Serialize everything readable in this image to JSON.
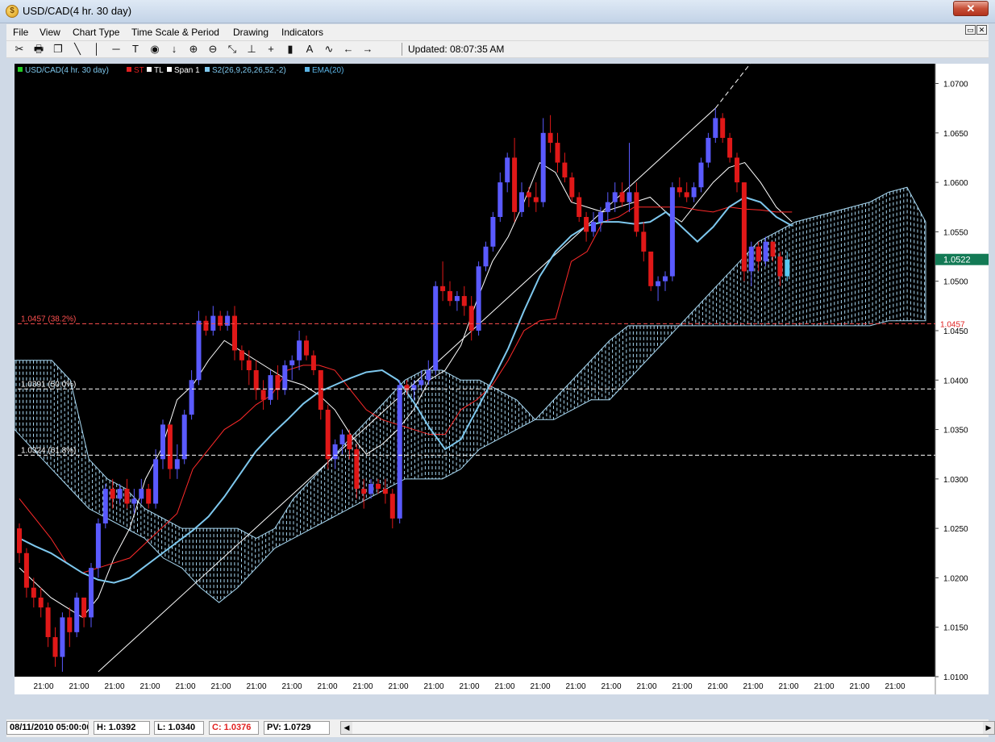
{
  "window": {
    "title": "USD/CAD(4 hr.  30 day)",
    "close_label": "✕"
  },
  "menu": [
    "File",
    "View",
    "Chart Type",
    "Time Scale & Period",
    "Drawing",
    "Indicators"
  ],
  "toolbar": {
    "icons": [
      "scissors-icon",
      "print-icon",
      "copy-icon",
      "line-icon",
      "vertical-line-icon",
      "horizontal-line-icon",
      "text-icon",
      "circle-icon",
      "arrow-down-icon",
      "zoom-in-icon",
      "zoom-out-icon",
      "fit-icon",
      "align-icon",
      "plus-icon",
      "bar-icon",
      "a-icon",
      "wave-icon",
      "arrow-left-icon",
      "arrow-right-icon"
    ],
    "glyphs": [
      "✂",
      "🖶",
      "❐",
      "╲",
      "│",
      "─",
      "T",
      "◉",
      "↓",
      "⊕",
      "⊖",
      "⤡",
      "⊥",
      "+",
      "▮",
      "A",
      "∿",
      "←",
      "→"
    ],
    "updated": "Updated: 08:07:35 AM"
  },
  "legend": [
    {
      "label": "USD/CAD(4 hr.  30 day)",
      "color": "#22cc22"
    },
    {
      "label": "ST",
      "color": "#e02020"
    },
    {
      "label": "TL",
      "color": "#ffffff"
    },
    {
      "label": "Span 1",
      "color": "#ffffff"
    },
    {
      "label": "S2(26,9,26,26,52,-2)",
      "color": "#7ec8ee"
    },
    {
      "label": "EMA(20)",
      "color": "#5ab4e6"
    }
  ],
  "colors": {
    "bull": "#5a5aff",
    "bear": "#e01818",
    "last": "#5ac8f0",
    "cloud": "#a8d8f2",
    "tenkan": "#ff2a2a",
    "kijun_line": "#ffffff",
    "ema": "#7ec8ee",
    "current_badge": "#137a55"
  },
  "chart_data": {
    "type": "candlestick",
    "symbol": "USD/CAD",
    "period": "4 hr.  30 day",
    "ylim": [
      1.01,
      1.072
    ],
    "y_ticks": [
      "1.0700",
      "1.0650",
      "1.0600",
      "1.0550",
      "1.0500",
      "1.0450",
      "1.0400",
      "1.0350",
      "1.0300",
      "1.0250",
      "1.0200",
      "1.0150",
      "1.0100"
    ],
    "x_ticks": [
      "21:00",
      "21:00",
      "21:00",
      "21:00",
      "21:00",
      "21:00",
      "21:00",
      "21:00",
      "21:00",
      "21:00",
      "21:00",
      "21:00",
      "21:00",
      "21:00",
      "21:00",
      "21:00",
      "21:00",
      "21:00",
      "21:00",
      "21:00",
      "21:00",
      "21:00",
      "21:00",
      "21:00",
      "21:00"
    ],
    "current_price": "1.0522",
    "fib_levels": [
      {
        "label": "1.0457 (38.2%)",
        "value": 1.0457,
        "color": "#ff5050"
      },
      {
        "label": "1.0391 (50.0%)",
        "value": 1.0391,
        "color": "#ffffff"
      },
      {
        "label": "1.0324 (61.8%)",
        "value": 1.0324,
        "color": "#ffffff"
      }
    ],
    "right_marker": "1.0457",
    "trendline": {
      "x": [
        11,
        185
      ],
      "y": [
        1.0105,
        1.074
      ]
    },
    "candles": [
      [
        1.025,
        1.0255,
        1.0215,
        1.0225
      ],
      [
        1.0225,
        1.023,
        1.018,
        1.019
      ],
      [
        1.019,
        1.02,
        1.017,
        1.018
      ],
      [
        1.018,
        1.019,
        1.016,
        1.017
      ],
      [
        1.017,
        1.0175,
        1.013,
        1.014
      ],
      [
        1.014,
        1.015,
        1.011,
        1.012
      ],
      [
        1.012,
        1.0165,
        1.0105,
        1.016
      ],
      [
        1.016,
        1.017,
        1.013,
        1.0145
      ],
      [
        1.0145,
        1.0185,
        1.014,
        1.018
      ],
      [
        1.018,
        1.0175,
        1.015,
        1.016
      ],
      [
        1.016,
        1.0215,
        1.015,
        1.021
      ],
      [
        1.021,
        1.026,
        1.02,
        1.0255
      ],
      [
        1.0255,
        1.0295,
        1.025,
        1.029
      ],
      [
        1.029,
        1.03,
        1.027,
        1.028
      ],
      [
        1.028,
        1.0295,
        1.0275,
        1.029
      ],
      [
        1.029,
        1.03,
        1.027,
        1.0275
      ],
      [
        1.0275,
        1.029,
        1.0265,
        1.028
      ],
      [
        1.028,
        1.03,
        1.0275,
        1.029
      ],
      [
        1.029,
        1.0295,
        1.027,
        1.0275
      ],
      [
        1.0275,
        1.033,
        1.027,
        1.032
      ],
      [
        1.032,
        1.036,
        1.031,
        1.0355
      ],
      [
        1.0355,
        1.035,
        1.03,
        1.031
      ],
      [
        1.031,
        1.0335,
        1.03,
        1.032
      ],
      [
        1.032,
        1.037,
        1.0315,
        1.0365
      ],
      [
        1.0365,
        1.041,
        1.036,
        1.04
      ],
      [
        1.04,
        1.047,
        1.0395,
        1.046
      ],
      [
        1.046,
        1.0465,
        1.0445,
        1.045
      ],
      [
        1.045,
        1.0475,
        1.0445,
        1.0465
      ],
      [
        1.0465,
        1.047,
        1.045,
        1.0455
      ],
      [
        1.0455,
        1.047,
        1.045,
        1.0465
      ],
      [
        1.0465,
        1.0475,
        1.042,
        1.043
      ],
      [
        1.043,
        1.0435,
        1.041,
        1.042
      ],
      [
        1.042,
        1.043,
        1.0395,
        1.041
      ],
      [
        1.041,
        1.042,
        1.038,
        1.039
      ],
      [
        1.039,
        1.04,
        1.037,
        1.038
      ],
      [
        1.038,
        1.041,
        1.0375,
        1.0405
      ],
      [
        1.0405,
        1.0415,
        1.038,
        1.039
      ],
      [
        1.039,
        1.042,
        1.0385,
        1.0415
      ],
      [
        1.0415,
        1.0425,
        1.04,
        1.042
      ],
      [
        1.042,
        1.045,
        1.041,
        1.044
      ],
      [
        1.044,
        1.0445,
        1.042,
        1.0425
      ],
      [
        1.0425,
        1.043,
        1.0405,
        1.041
      ],
      [
        1.041,
        1.0405,
        1.036,
        1.037
      ],
      [
        1.037,
        1.0375,
        1.031,
        1.032
      ],
      [
        1.032,
        1.034,
        1.031,
        1.0335
      ],
      [
        1.0335,
        1.035,
        1.0325,
        1.0345
      ],
      [
        1.0345,
        1.035,
        1.032,
        1.033
      ],
      [
        1.033,
        1.0335,
        1.028,
        1.029
      ],
      [
        1.029,
        1.03,
        1.027,
        1.0285
      ],
      [
        1.0285,
        1.03,
        1.028,
        1.0295
      ],
      [
        1.0295,
        1.03,
        1.0285,
        1.029
      ],
      [
        1.029,
        1.03,
        1.0275,
        1.0285
      ],
      [
        1.0285,
        1.029,
        1.025,
        1.026
      ],
      [
        1.026,
        1.04,
        1.0255,
        1.0395
      ],
      [
        1.0395,
        1.04,
        1.0385,
        1.039
      ],
      [
        1.039,
        1.04,
        1.038,
        1.0395
      ],
      [
        1.0395,
        1.041,
        1.039,
        1.04
      ],
      [
        1.04,
        1.042,
        1.0395,
        1.041
      ],
      [
        1.041,
        1.05,
        1.0405,
        1.0495
      ],
      [
        1.0495,
        1.052,
        1.048,
        1.049
      ],
      [
        1.049,
        1.05,
        1.0475,
        1.048
      ],
      [
        1.048,
        1.049,
        1.047,
        1.0485
      ],
      [
        1.0485,
        1.0495,
        1.0465,
        1.0475
      ],
      [
        1.0475,
        1.0485,
        1.044,
        1.045
      ],
      [
        1.045,
        1.052,
        1.0445,
        1.0515
      ],
      [
        1.0515,
        1.054,
        1.051,
        1.0535
      ],
      [
        1.0535,
        1.057,
        1.053,
        1.0565
      ],
      [
        1.0565,
        1.061,
        1.056,
        1.06
      ],
      [
        1.06,
        1.063,
        1.059,
        1.0625
      ],
      [
        1.0625,
        1.0645,
        1.056,
        1.057
      ],
      [
        1.057,
        1.06,
        1.0565,
        1.059
      ],
      [
        1.059,
        1.0595,
        1.0575,
        1.0585
      ],
      [
        1.0585,
        1.06,
        1.057,
        1.058
      ],
      [
        1.058,
        1.0665,
        1.0575,
        1.065
      ],
      [
        1.065,
        1.0668,
        1.063,
        1.064
      ],
      [
        1.064,
        1.065,
        1.061,
        1.062
      ],
      [
        1.062,
        1.063,
        1.06,
        1.0605
      ],
      [
        1.0605,
        1.061,
        1.058,
        1.0585
      ],
      [
        1.0585,
        1.059,
        1.056,
        1.0565
      ],
      [
        1.0565,
        1.057,
        1.054,
        1.055
      ],
      [
        1.055,
        1.057,
        1.0545,
        1.056
      ],
      [
        1.056,
        1.0575,
        1.055,
        1.057
      ],
      [
        1.057,
        1.059,
        1.056,
        1.058
      ],
      [
        1.058,
        1.06,
        1.057,
        1.059
      ],
      [
        1.059,
        1.06,
        1.0575,
        1.058
      ],
      [
        1.058,
        1.064,
        1.057,
        1.059
      ],
      [
        1.059,
        1.06,
        1.0545,
        1.055
      ],
      [
        1.055,
        1.056,
        1.052,
        1.053
      ],
      [
        1.053,
        1.051,
        1.049,
        1.0495
      ],
      [
        1.0495,
        1.0505,
        1.048,
        1.05
      ],
      [
        1.05,
        1.051,
        1.049,
        1.0505
      ],
      [
        1.0505,
        1.06,
        1.05,
        1.0595
      ],
      [
        1.0595,
        1.0605,
        1.0585,
        1.059
      ],
      [
        1.059,
        1.06,
        1.058,
        1.0585
      ],
      [
        1.0585,
        1.06,
        1.058,
        1.0595
      ],
      [
        1.0595,
        1.0625,
        1.059,
        1.062
      ],
      [
        1.062,
        1.065,
        1.0615,
        1.0645
      ],
      [
        1.0645,
        1.0675,
        1.064,
        1.0665
      ],
      [
        1.0665,
        1.067,
        1.064,
        1.0645
      ],
      [
        1.0645,
        1.065,
        1.062,
        1.0625
      ],
      [
        1.0625,
        1.063,
        1.059,
        1.06
      ],
      [
        1.06,
        1.06,
        1.05,
        1.051
      ],
      [
        1.051,
        1.054,
        1.0495,
        1.0535
      ],
      [
        1.0535,
        1.054,
        1.051,
        1.052
      ],
      [
        1.052,
        1.0545,
        1.0515,
        1.054
      ],
      [
        1.054,
        1.054,
        1.052,
        1.0525
      ],
      [
        1.0525,
        1.053,
        1.0495,
        1.0505
      ],
      [
        1.0505,
        1.053,
        1.05,
        1.0522
      ]
    ],
    "ema20": [
      1.024,
      1.0232,
      1.0225,
      1.0215,
      1.0205,
      1.0198,
      1.0195,
      1.02,
      1.0212,
      1.0224,
      1.0236,
      1.0248,
      1.0262,
      1.0282,
      1.0305,
      1.0328,
      1.0345,
      1.036,
      1.0376,
      1.0388,
      1.0395,
      1.0402,
      1.0408,
      1.041,
      1.04,
      1.0378,
      1.0352,
      1.033,
      1.034,
      1.037,
      1.04,
      1.0432,
      1.047,
      1.0505,
      1.053,
      1.0546,
      1.0556,
      1.056,
      1.056,
      1.0558,
      1.056,
      1.057,
      1.0555,
      1.054,
      1.0555,
      1.0575,
      1.0585,
      1.058,
      1.0565,
      1.0556
    ],
    "tenkan": [
      1.028,
      1.026,
      1.024,
      1.0215,
      1.0205,
      1.021,
      1.0215,
      1.022,
      1.0235,
      1.025,
      1.0265,
      1.031,
      1.033,
      1.035,
      1.036,
      1.0375,
      1.0385,
      1.041,
      1.0415,
      1.0415,
      1.041,
      1.039,
      1.037,
      1.036,
      1.0355,
      1.035,
      1.0345,
      1.0345,
      1.037,
      1.038,
      1.0395,
      1.042,
      1.045,
      1.046,
      1.0462,
      1.052,
      1.053,
      1.056,
      1.0565,
      1.0575,
      1.0575,
      1.0575,
      1.0575,
      1.0572,
      1.057,
      1.0575,
      1.0573,
      1.0572,
      1.057,
      1.057
    ],
    "kijun": [
      1.021,
      1.0195,
      1.018,
      1.017,
      1.016,
      1.018,
      1.022,
      1.025,
      1.03,
      1.033,
      1.038,
      1.0395,
      1.042,
      1.044,
      1.043,
      1.042,
      1.041,
      1.04,
      1.0395,
      1.0385,
      1.037,
      1.0345,
      1.0325,
      1.0335,
      1.035,
      1.037,
      1.04,
      1.041,
      1.0435,
      1.048,
      1.052,
      1.0545,
      1.058,
      1.062,
      1.061,
      1.058,
      1.0575,
      1.057,
      1.0575,
      1.058,
      1.0585,
      1.057,
      1.056,
      1.058,
      1.06,
      1.0615,
      1.062,
      1.06,
      1.0575,
      1.056
    ],
    "cloud_a": [
      1.042,
      1.042,
      1.042,
      1.04,
      1.032,
      1.03,
      1.029,
      1.027,
      1.026,
      1.025,
      1.025,
      1.025,
      1.025,
      1.024,
      1.025,
      1.028,
      1.03,
      1.032,
      1.034,
      1.036,
      1.038,
      1.04,
      1.041,
      1.041,
      1.04,
      1.04,
      1.039,
      1.038,
      1.036,
      1.036,
      1.037,
      1.038,
      1.038,
      1.04,
      1.042,
      1.044,
      1.046,
      1.048,
      1.05,
      1.052,
      1.054,
      1.055,
      1.056,
      1.0565,
      1.057,
      1.0575,
      1.058,
      1.059,
      1.0595,
      1.056
    ],
    "cloud_b": [
      1.035,
      1.033,
      1.031,
      1.029,
      1.027,
      1.026,
      1.025,
      1.024,
      1.022,
      1.021,
      1.019,
      1.0175,
      1.019,
      1.021,
      1.023,
      1.024,
      1.025,
      1.026,
      1.027,
      1.028,
      1.029,
      1.03,
      1.03,
      1.03,
      1.031,
      1.033,
      1.034,
      1.035,
      1.036,
      1.038,
      1.04,
      1.042,
      1.044,
      1.0455,
      1.0455,
      1.0455,
      1.0455,
      1.0455,
      1.0455,
      1.0455,
      1.0455,
      1.0455,
      1.0455,
      1.0455,
      1.0455,
      1.0455,
      1.0455,
      1.046,
      1.046,
      1.046
    ]
  },
  "status": {
    "date": "08/11/2010 05:00:00",
    "high": "H: 1.0392",
    "low": "L: 1.0340",
    "close": "C: 1.0376",
    "pv": "PV: 1.0729"
  }
}
